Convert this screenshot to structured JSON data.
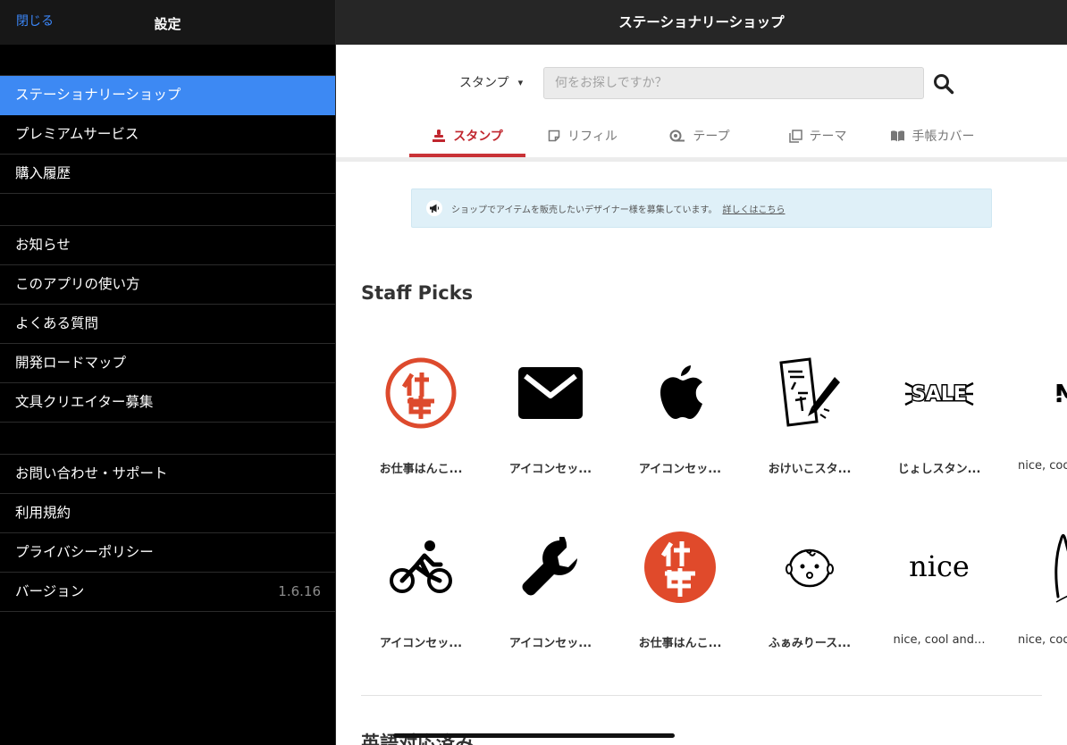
{
  "left_panel": {
    "close_label": "閉じる",
    "title": "設定",
    "groups": [
      [
        {
          "label": "ステーショナリーショップ",
          "active": true
        },
        {
          "label": "プレミアムサービス"
        },
        {
          "label": "購入履歴"
        }
      ],
      [
        {
          "label": "お知らせ"
        },
        {
          "label": "このアプリの使い方"
        },
        {
          "label": "よくある質問"
        },
        {
          "label": "開発ロードマップ"
        },
        {
          "label": "文具クリエイター募集"
        }
      ],
      [
        {
          "label": "お問い合わせ・サポート"
        },
        {
          "label": "利用規約"
        },
        {
          "label": "プライバシーポリシー"
        },
        {
          "label": "バージョン",
          "value": "1.6.16"
        }
      ]
    ],
    "active_color": "#3d89f3"
  },
  "right_panel": {
    "title": "ステーショナリーショップ",
    "search": {
      "category": "スタンプ",
      "placeholder": "何をお探しですか？"
    },
    "tabs": [
      {
        "label": "スタンプ",
        "icon": "stamp-icon",
        "active": true
      },
      {
        "label": "リフィル",
        "icon": "refill-icon"
      },
      {
        "label": "テープ",
        "icon": "tape-icon"
      },
      {
        "label": "テーマ",
        "icon": "theme-icon"
      },
      {
        "label": "手帳カバー",
        "icon": "book-cover-icon"
      }
    ],
    "notice": {
      "text": "ショップでアイテムを販売したいデザイナー様を募集しています。",
      "link": "詳しくはこちら"
    },
    "section_title": "Staff Picks",
    "items": [
      {
        "label": "お仕事はんこ...",
        "icon": "shigoto-stamp-outline-icon"
      },
      {
        "label": "アイコンセッ...",
        "icon": "envelope-icon"
      },
      {
        "label": "アイコンセッ...",
        "icon": "apple-icon"
      },
      {
        "label": "おけいこスタ...",
        "icon": "practice-paper-brush-icon"
      },
      {
        "label": "じょしスタン...",
        "icon": "sale-icon"
      },
      {
        "label": "nice, coo",
        "icon": "nice-lettering-icon"
      },
      {
        "label": "アイコンセッ...",
        "icon": "bicycle-icon"
      },
      {
        "label": "アイコンセッ...",
        "icon": "wrench-icon"
      },
      {
        "label": "お仕事はんこ...",
        "icon": "shigoto-stamp-filled-icon"
      },
      {
        "label": "ふぁみりース...",
        "icon": "baby-face-icon"
      },
      {
        "label": "nice, cool and...",
        "icon": "nice-text-icon"
      },
      {
        "label": "nice, coo",
        "icon": "script-lettering-icon"
      }
    ],
    "next_section_title": "英語対応済み",
    "accent_color": "#c93236"
  }
}
